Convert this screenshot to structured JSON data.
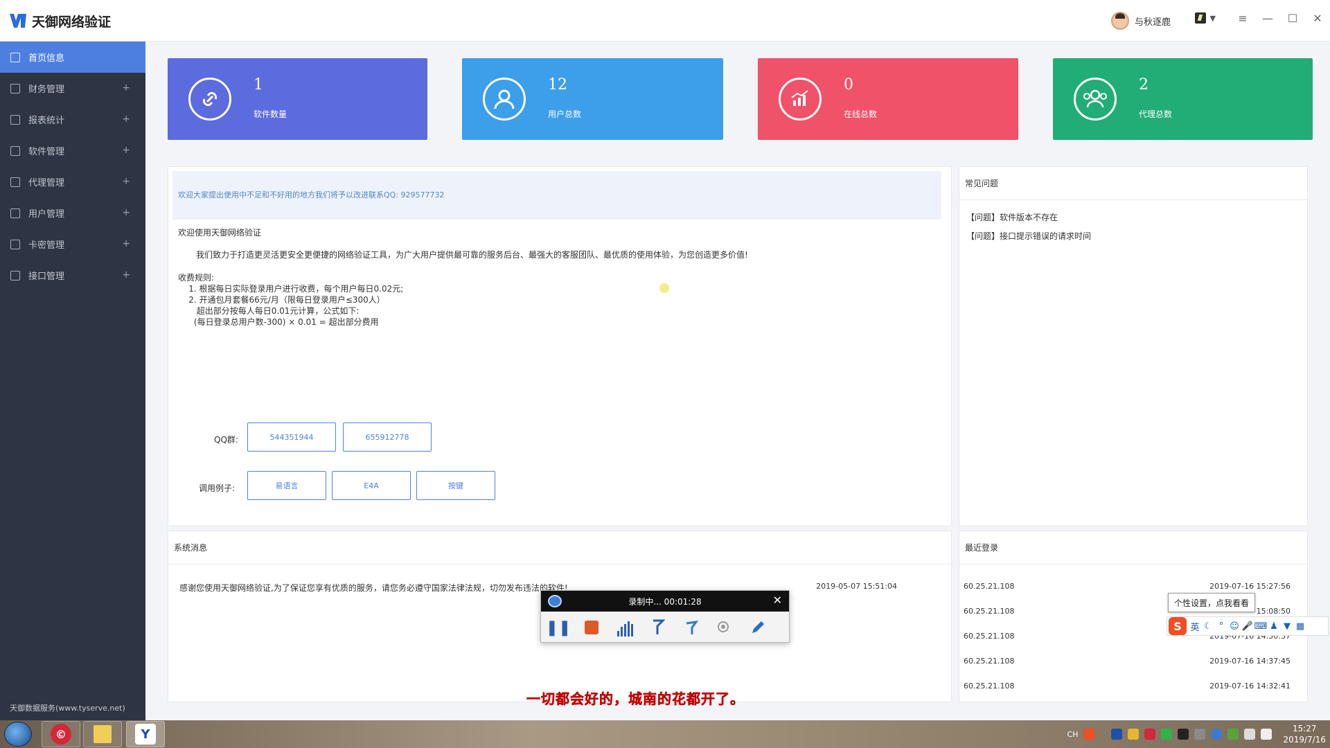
{
  "app": {
    "title": "天御网络验证"
  },
  "user": {
    "name": "与秋逐鹿"
  },
  "sidebar": {
    "items": [
      {
        "label": "首页信息",
        "expandable": false,
        "active": true
      },
      {
        "label": "财务管理",
        "expandable": true
      },
      {
        "label": "报表统计",
        "expandable": true
      },
      {
        "label": "软件管理",
        "expandable": true
      },
      {
        "label": "代理管理",
        "expandable": true
      },
      {
        "label": "用户管理",
        "expandable": true
      },
      {
        "label": "卡密管理",
        "expandable": true
      },
      {
        "label": "接口管理",
        "expandable": true
      }
    ],
    "expand_glyph": "+",
    "footer": "天御数据服务(www.tyserve.net)"
  },
  "stats": [
    {
      "value": "1",
      "label": "软件数量",
      "color": "#5c6bde",
      "icon": "link-icon"
    },
    {
      "value": "12",
      "label": "用户总数",
      "color": "#3d9ee9",
      "icon": "user-icon"
    },
    {
      "value": "0",
      "label": "在线总数",
      "color": "#ef5269",
      "icon": "chart-icon"
    },
    {
      "value": "2",
      "label": "代理总数",
      "color": "#21ad75",
      "icon": "group-icon"
    }
  ],
  "main": {
    "notice": "欢迎大家提出使用中不足和不好用的地方我们将予以改进联系QQ: 929577732",
    "intro_title": "欢迎使用天御网络验证",
    "intro_body": "我们致力于打造更灵活更安全更便捷的网络验证工具，为广大用户提供最可靠的服务后台、最强大的客服团队、最优质的使用体验，为您创造更多价值!",
    "rules_title": "收费规则:",
    "rules": [
      "    1. 根据每日实际登录用户进行收费，每个用户每日0.02元;",
      "    2. 开通包月套餐66元/月（限每日登录用户≤300人）",
      "       超出部分按每人每日0.01元计算，公式如下:",
      "      (每日登录总用户数-300) × 0.01 = 超出部分费用"
    ],
    "qq_label": "QQ群:",
    "qq_groups": [
      "544351944",
      "655912778"
    ],
    "examples_label": "调用例子:",
    "examples": [
      "易语言",
      "E4A",
      "按键"
    ]
  },
  "faq": {
    "title": "常见问题",
    "items": [
      "【问题】软件版本不存在",
      "【问题】接口提示错误的请求时间"
    ]
  },
  "system": {
    "title": "系统消息",
    "message": "感谢您使用天御网络验证,为了保证您享有优质的服务，请您务必遵守国家法律法规，切勿发布违法的软件!",
    "time": "2019-05-07 15:51:04"
  },
  "recent_login": {
    "title": "最近登录",
    "rows": [
      {
        "ip": "60.25.21.108",
        "time": "2019-07-16 15:27:56"
      },
      {
        "ip": "60.25.21.108",
        "time": "15:08:50"
      },
      {
        "ip": "60.25.21.108",
        "time": "2019-07-16 14:50:37"
      },
      {
        "ip": "60.25.21.108",
        "time": "2019-07-16 14:37:45"
      },
      {
        "ip": "60.25.21.108",
        "time": "2019-07-16 14:32:41"
      }
    ]
  },
  "recorder": {
    "status": "录制中... 00:01:28"
  },
  "subtitle": "一切都会好的，城南的花都开了。",
  "ime": {
    "tip": "个性设置，点我看看",
    "lang": "英"
  },
  "taskbar": {
    "ime_indicator": "CH",
    "time": "15:27",
    "date": "2019/7/16"
  }
}
